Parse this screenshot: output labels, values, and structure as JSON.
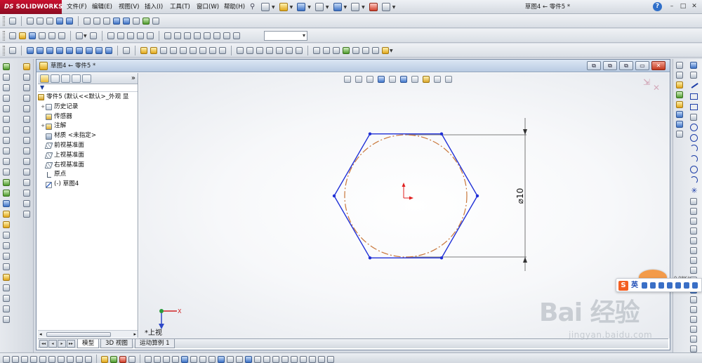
{
  "app": {
    "brand_prefix": "DS",
    "brand_name": "SOLIDWORKS",
    "window_title": "草图4 ← 零件5 *"
  },
  "menu": [
    "文件(F)",
    "编辑(E)",
    "视图(V)",
    "插入(I)",
    "工具(T)",
    "窗口(W)",
    "帮助(H)"
  ],
  "help_label": "?",
  "window_controls": [
    "–",
    "□",
    "✕"
  ],
  "document": {
    "title": "草图4 ← 零件5 *",
    "controls": [
      "⧉",
      "⧉",
      "⧉",
      "▭",
      "✕"
    ]
  },
  "feature_manager": {
    "more": "»",
    "filter": "▼",
    "root": "零件5  (默认<<默认>_外观 显",
    "nodes": [
      {
        "toggle": "+",
        "label": "历史记录"
      },
      {
        "toggle": "",
        "label": "传感器"
      },
      {
        "toggle": "+",
        "label": "注解"
      },
      {
        "toggle": "",
        "label": "材质 <未指定>"
      },
      {
        "toggle": "",
        "label": "前视基准面"
      },
      {
        "toggle": "",
        "label": "上视基准面"
      },
      {
        "toggle": "",
        "label": "右视基准面"
      },
      {
        "toggle": "",
        "label": "原点"
      },
      {
        "toggle": "",
        "label": "(-) 草图4"
      }
    ]
  },
  "graphics": {
    "dimension_label": "⌀10",
    "view_label": "*上视",
    "triad_x": "X",
    "polygon_sides": 6
  },
  "bottom_tabs": [
    "模型",
    "3D 视图",
    "运动算例 1"
  ],
  "ime": {
    "brand": "S",
    "lang": "英",
    "speed": "0.08K/s"
  },
  "watermark": {
    "brand": "Bai 经验",
    "url": "jingyan.baidu.com"
  },
  "colors": {
    "sketch_blue": "#1f2fd6",
    "circle_orange": "#c8763a",
    "origin_red": "#e02020",
    "dimension_gray": "#555555"
  }
}
